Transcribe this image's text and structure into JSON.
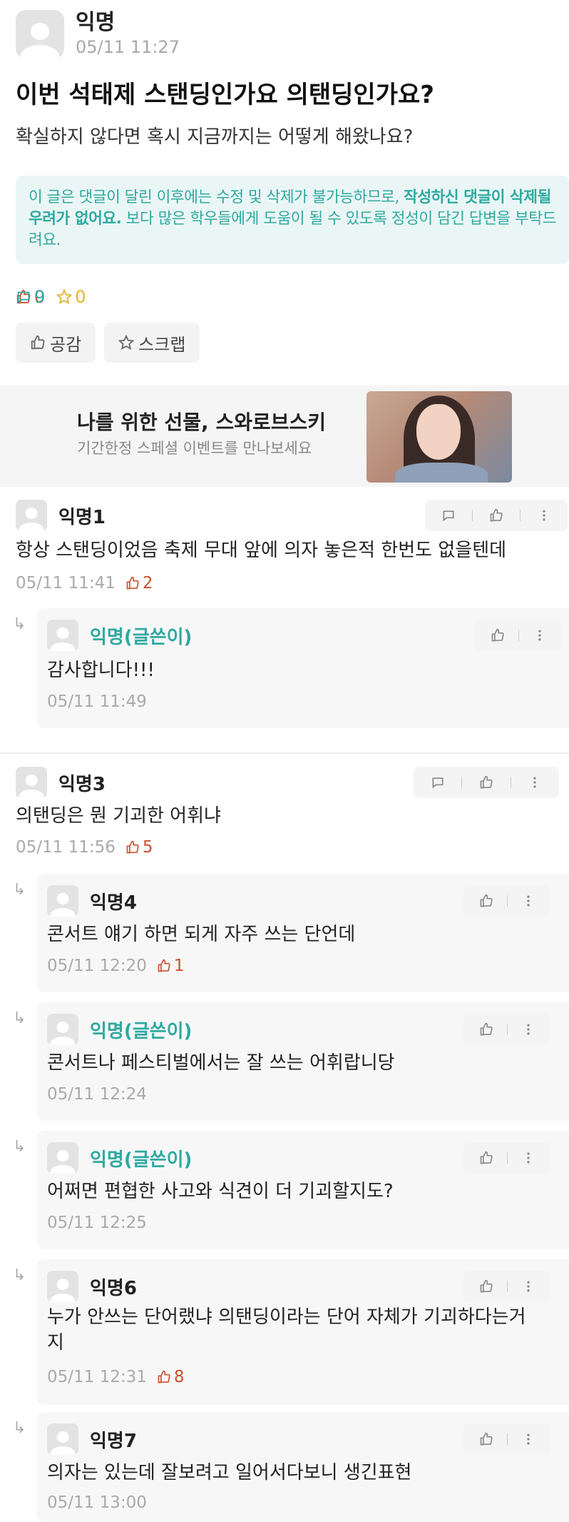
{
  "post": {
    "author": "익명",
    "time": "05/11 11:27",
    "title": "이번 석태제 스탠딩인가요 의탠딩인가요?",
    "body": "확실하지 않다면 혹시 지금까지는 어떻게 해왔나요?",
    "notice_prefix": "이 글은 댓글이 달린 이후에는 수정 및 삭제가 불가능하므로, ",
    "notice_bold": "작성하신 댓글이 삭제될 우려가 없어요.",
    "notice_suffix": " 보다 많은 학우들에게 도움이 될 수 있도록 정성이 담긴 답변을 부탁드려요.",
    "likes": "0",
    "comments": "9",
    "scraps": "0",
    "empathy_label": "공감",
    "scrap_label": "스크랩"
  },
  "ad": {
    "title": "나를 위한 선물, 스와로브스키",
    "subtitle": "기간한정 스페셜 이벤트를 만나보세요"
  },
  "comments": [
    {
      "author": "익명1",
      "text": "항상 스탠딩이었음 축제 무대 앞에 의자 놓은적 한번도 없을텐데",
      "time": "05/11 11:41",
      "likes": "2"
    },
    {
      "author": "익명(글쓴이)",
      "text": "감사합니다!!!",
      "time": "05/11 11:49"
    },
    {
      "author": "익명3",
      "text": "의탠딩은 뭔 기괴한 어휘냐",
      "time": "05/11 11:56",
      "likes": "5"
    },
    {
      "author": "익명4",
      "text": "콘서트 얘기 하면 되게 자주 쓰는 단언데",
      "time": "05/11 12:20",
      "likes": "1"
    },
    {
      "author": "익명(글쓴이)",
      "text": "콘서트나 페스티벌에서는 잘 쓰는 어휘랍니당",
      "time": "05/11 12:24"
    },
    {
      "author": "익명(글쓴이)",
      "text": "어쩌면 편협한 사고와 식견이 더 기괴할지도?",
      "time": "05/11 12:25"
    },
    {
      "author": "익명6",
      "text_line1": "누가 안쓰는 단어랬냐 의탠딩이라는 단어 자체가 기괴하다는거",
      "text_line2": "지",
      "time": "05/11 12:31",
      "likes": "8"
    },
    {
      "author": "익명7",
      "text": "의자는 있는데 잘보려고 일어서다보니 생긴표현",
      "time": "05/11 13:00"
    }
  ],
  "icons": {
    "reply_arrow": "↳"
  },
  "colors": {
    "accent": "#2fa9a1",
    "like": "#c8502f",
    "scrap": "#e5b431"
  }
}
